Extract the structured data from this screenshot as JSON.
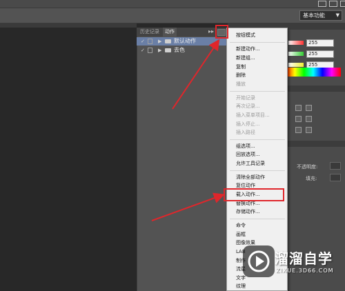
{
  "workspace_select": {
    "value": "基本功能"
  },
  "panel": {
    "tabs": [
      {
        "label": "历史记录"
      },
      {
        "label": "动作"
      }
    ],
    "actions": [
      {
        "label": "默认动作",
        "checked": true
      },
      {
        "label": "去色",
        "checked": true
      }
    ]
  },
  "menu": {
    "items": [
      {
        "label": "按钮模式",
        "enabled": true
      },
      {
        "label": "新建动作...",
        "enabled": true
      },
      {
        "label": "新建组...",
        "enabled": true
      },
      {
        "label": "复制",
        "enabled": true
      },
      {
        "label": "删除",
        "enabled": true
      },
      {
        "label": "播放",
        "enabled": false
      },
      {
        "label": "开始记录",
        "enabled": false
      },
      {
        "label": "再次记录...",
        "enabled": false
      },
      {
        "label": "插入菜单项目...",
        "enabled": false
      },
      {
        "label": "插入停止...",
        "enabled": false
      },
      {
        "label": "插入路径",
        "enabled": false
      },
      {
        "label": "组选项...",
        "enabled": true
      },
      {
        "label": "回放选项...",
        "enabled": true
      },
      {
        "label": "允许工具记录",
        "enabled": true
      },
      {
        "label": "清除全部动作",
        "enabled": true
      },
      {
        "label": "复位动作",
        "enabled": true
      },
      {
        "label": "载入动作...",
        "enabled": true,
        "highlighted_by_annotation": true
      },
      {
        "label": "替换动作...",
        "enabled": true
      },
      {
        "label": "存储动作...",
        "enabled": true
      },
      {
        "label": "命令",
        "enabled": true
      },
      {
        "label": "画框",
        "enabled": true
      },
      {
        "label": "图像效果",
        "enabled": true
      },
      {
        "label": "LAB",
        "enabled": true
      },
      {
        "label": "制作",
        "enabled": true
      },
      {
        "label": "流星",
        "enabled": true
      },
      {
        "label": "文字",
        "enabled": true
      },
      {
        "label": "纹理",
        "enabled": true
      }
    ]
  },
  "color_panel": {
    "values": [
      "255",
      "255",
      "255"
    ]
  },
  "layers_panel": {
    "opacity_label": "不透明度:",
    "fill_label": "填充:"
  },
  "watermark": {
    "title": "溜溜自学",
    "subtitle": "ZIXUE.3D66.COM"
  },
  "colors": {
    "annotation_red": "#e0262b",
    "selected_row": "#6a7fa6"
  }
}
